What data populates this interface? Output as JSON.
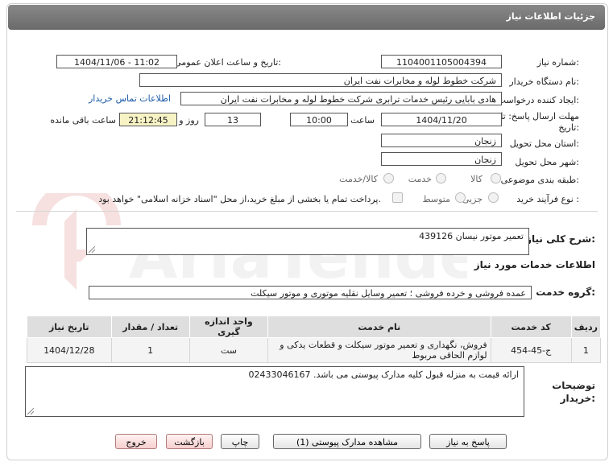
{
  "page": {
    "title": "جزئیات اطلاعات نیاز"
  },
  "fields": {
    "need_number_label": "شماره نیاز:",
    "need_number": "1104001105004394",
    "announce_label": "تاریخ و ساعت اعلان عمومی:",
    "announce_value": "1404/11/06 - 11:02",
    "buyer_org_label": "نام دستگاه خریدار:",
    "buyer_org": "شرکت خطوط لوله و مخابرات نفت ایران",
    "creator_label": "ایجاد کننده درخواست:",
    "creator": "هادی بابایی رئیس خدمات ترابری شرکت خطوط لوله و مخابرات نفت ایران",
    "contact_link": "اطلاعات تماس خریدار",
    "deadline_label_line1": "مهلت ارسال پاسخ: تا",
    "deadline_label_line2": "تاریخ:",
    "deadline_date": "1404/11/20",
    "time_label": "ساعت",
    "deadline_time": "10:00",
    "days_value": "13",
    "days_label": "روز و",
    "remaining_time": "21:12:45",
    "remaining_label": "ساعت باقی مانده",
    "province_label": "استان محل تحویل:",
    "province": "زنجان",
    "city_label": "شهر محل تحویل:",
    "city": "زنجان",
    "category_label": "طبقه بندی موضوعی:",
    "category_options": [
      "کالا",
      "خدمت",
      "کالا/خدمت"
    ],
    "process_label": "نوع فرآیند خرید :",
    "process_options": [
      "جزیی",
      "متوسط"
    ],
    "payment_note": "پرداخت تمام یا بخشی از مبلغ خرید،از محل \"اسناد خزانه اسلامی\" خواهد بود."
  },
  "summary": {
    "label": "شرح کلی نیاز:",
    "value": "تعمیر موتور نیسان 439126"
  },
  "services_section": {
    "title": "اطلاعات خدمات مورد نیاز",
    "group_label": "گروه خدمت:",
    "group_value": "عمده فروشی و خرده فروشی ؛ تعمیر وسایل نقلیه موتوری و موتور سیکلت"
  },
  "table": {
    "headers": [
      "ردیف",
      "کد خدمت",
      "نام خدمت",
      "واحد اندازه گیری",
      "تعداد / مقدار",
      "تاریخ نیاز"
    ],
    "rows": [
      {
        "row": "1",
        "code": "ج-45-454",
        "name": "فروش، نگهداری و تعمیر موتور سیکلت و قطعات یدکی و لوازم الحاقی مربوط",
        "unit": "ست",
        "qty": "1",
        "date": "1404/12/28"
      }
    ]
  },
  "notes": {
    "label_line1": "توضیحات",
    "label_line2": "خریدار:",
    "value": "ارائه قیمت به منزله قبول کلیه مدارک پیوستی می باشد. 02433046167"
  },
  "buttons": {
    "reply": "پاسخ به نیاز",
    "attachments": "مشاهده مدارک پیوستی (1)",
    "print": "چاپ",
    "back": "بازگشت",
    "exit": "خروج"
  },
  "watermark": {
    "text": "AriaTender.neT"
  },
  "colors": {
    "title_bar": "#777777",
    "link": "#1a5aa8",
    "timer_bg": "#f7f3c5",
    "exit_button": "#f7cfcf"
  }
}
